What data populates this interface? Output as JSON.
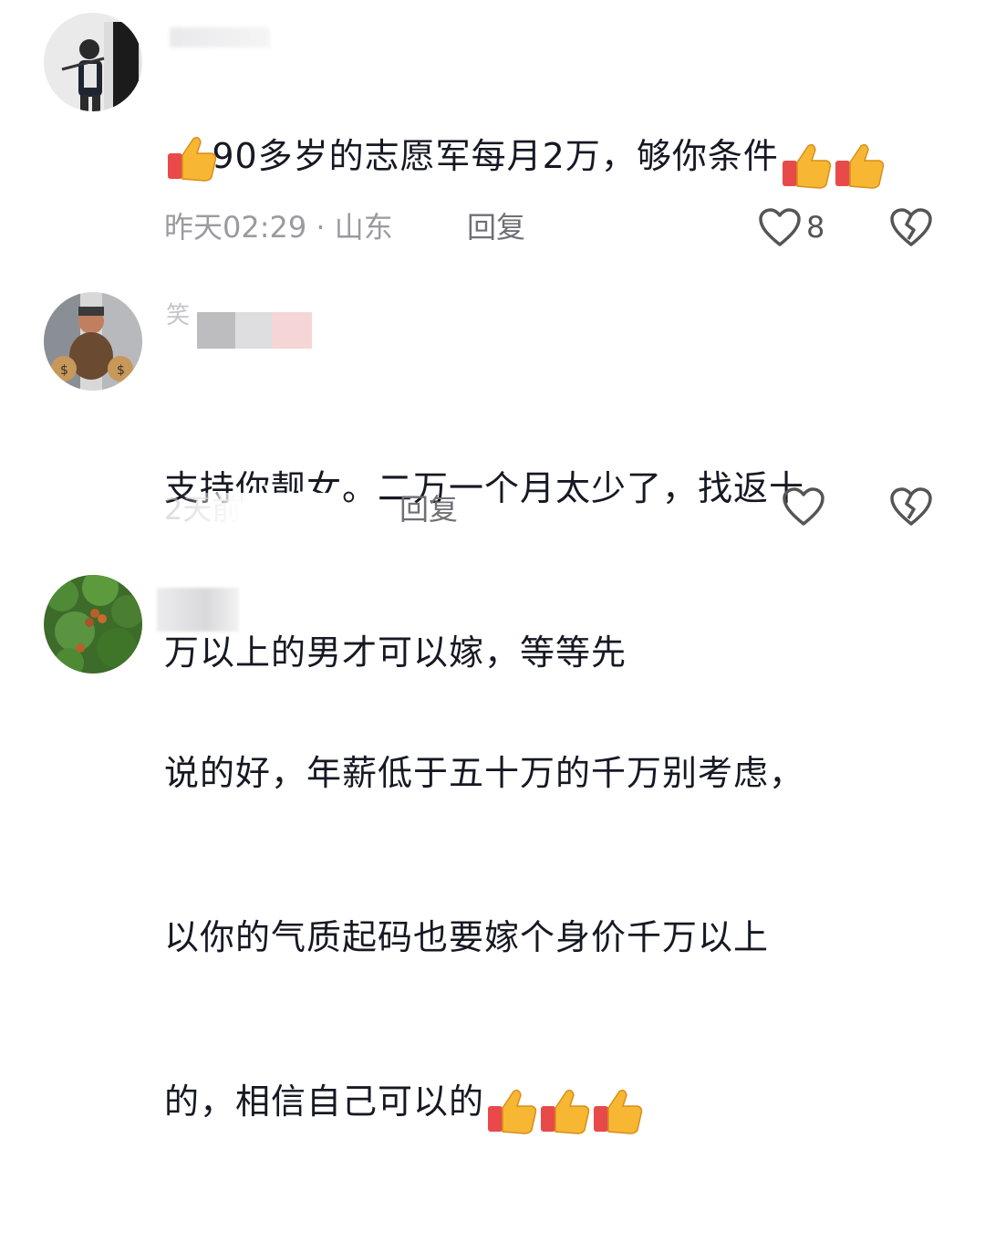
{
  "comments": [
    {
      "username": "",
      "text": "90多岁的志愿军每月2万，够你条件",
      "emoji_count": 3,
      "timestamp": "昨天02:29 · 山东",
      "reply_label": "回复",
      "like_count": "8"
    },
    {
      "username": "笑",
      "text_line1": "支持你靓女。二万一个月太少了，找返十",
      "text_line2": "万以上的男才可以嫁，等等先",
      "timestamp": "2天前",
      "reply_label": "回复"
    },
    {
      "username": "",
      "text_line1": "说的好，年薪低于五十万的千万别考虑，",
      "text_line2": "以你的气质起码也要嫁个身价千万以上",
      "text_line3": "的，相信自己可以的",
      "emoji_count": 3
    }
  ],
  "icons": {
    "like": "heart-outline-icon",
    "dislike": "broken-heart-icon",
    "emoji": "thumbs-up-emoji"
  },
  "colors": {
    "text": "#161823",
    "meta": "#9a9aa0",
    "reply": "#6f6f75",
    "icon": "#555555"
  }
}
